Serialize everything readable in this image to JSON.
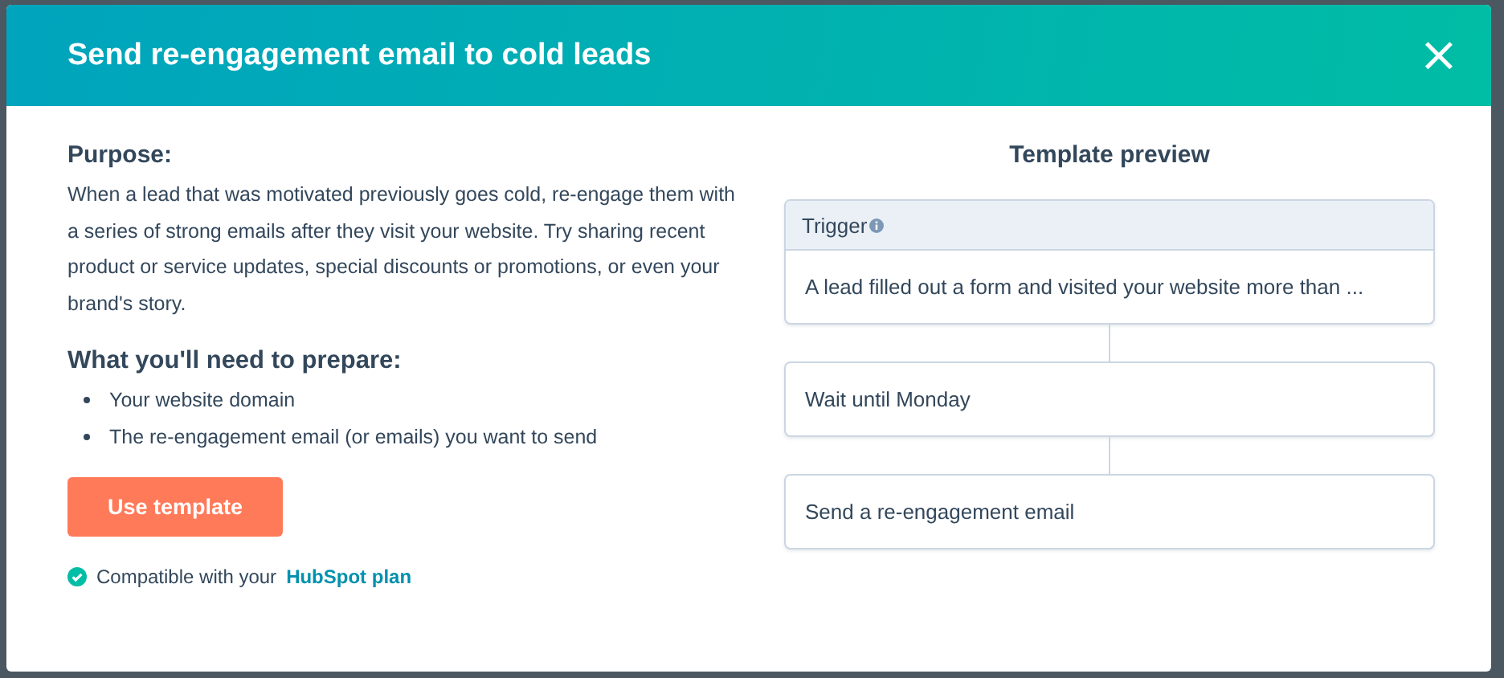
{
  "dialog": {
    "title": "Send re-engagement email to cold leads",
    "close_icon": "×"
  },
  "purpose": {
    "heading": "Purpose:",
    "text": "When a lead that was motivated previously goes cold, re-engage them with a series of strong emails after they visit your website. Try sharing recent product or service updates, special discounts or promotions, or even your brand's story."
  },
  "prepare": {
    "heading": "What you'll need to prepare:",
    "items": [
      "Your website domain",
      "The re-engagement email (or emails) you want to send"
    ]
  },
  "button": "Use template",
  "compatibility": {
    "text": "Compatible with your",
    "link": "HubSpot plan"
  },
  "preview": {
    "title": "Template preview",
    "steps": [
      {
        "kind": "trigger",
        "header": "Trigger",
        "text": "A lead filled out a form and visited your website more than ..."
      },
      {
        "kind": "action",
        "text": "Wait until Monday"
      },
      {
        "kind": "action",
        "text": "Send a re-engagement email"
      }
    ]
  }
}
